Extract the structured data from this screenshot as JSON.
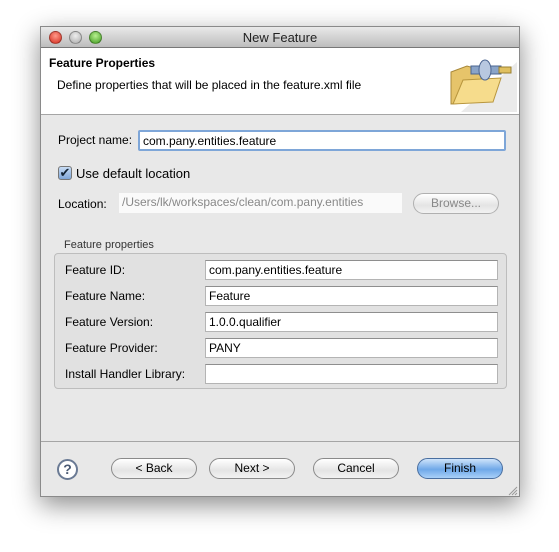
{
  "window": {
    "title": "New Feature"
  },
  "header": {
    "title": "Feature Properties",
    "description": "Define properties that will be placed in the feature.xml file",
    "icon": "folder-plugin-icon"
  },
  "project": {
    "label": "Project name:",
    "value": "com.pany.entities.feature"
  },
  "use_default_location": {
    "label": "Use default location",
    "checked": true
  },
  "location": {
    "label": "Location:",
    "value": "/Users/lk/workspaces/clean/com.pany.entities",
    "browse_label": "Browse..."
  },
  "feature_properties": {
    "title": "Feature properties",
    "rows": [
      {
        "label": "Feature ID:",
        "value": "com.pany.entities.feature"
      },
      {
        "label": "Feature Name:",
        "value": "Feature"
      },
      {
        "label": "Feature Version:",
        "value": "1.0.0.qualifier"
      },
      {
        "label": "Feature Provider:",
        "value": "PANY"
      },
      {
        "label": "Install Handler Library:",
        "value": ""
      }
    ]
  },
  "buttons": {
    "help": "?",
    "back": "< Back",
    "next": "Next >",
    "cancel": "Cancel",
    "finish": "Finish"
  }
}
